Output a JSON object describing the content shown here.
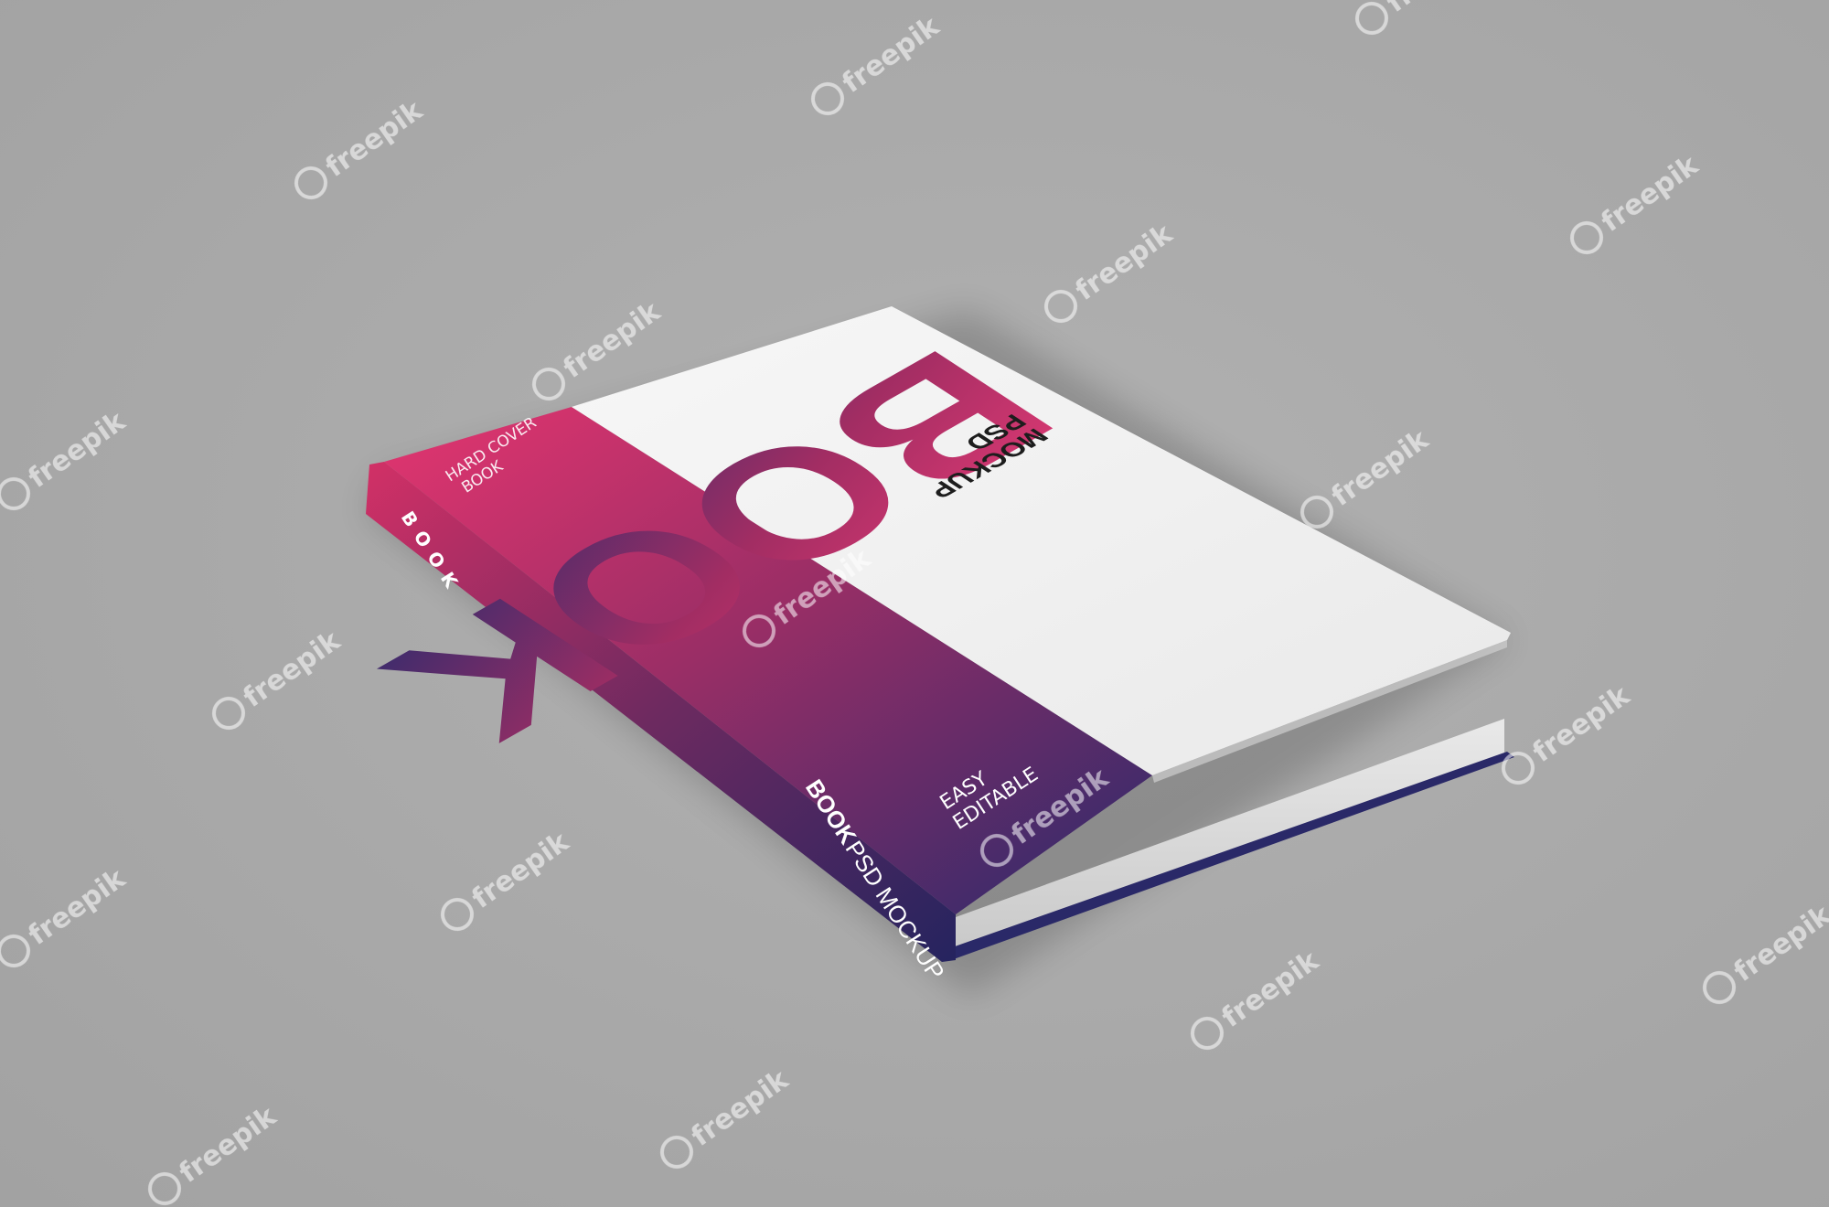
{
  "cover": {
    "big_word": "BOOK",
    "subtitle_line1": "PSD",
    "subtitle_line2": "MOCKUP",
    "tag_line1": "EASY",
    "tag_line2": "EDITABLE",
    "left_line1": "HARD COVER",
    "left_line2": "BOOK",
    "left_vertical": "BOOK",
    "bottom_bold": "BOOK",
    "bottom_regular": "PSD MOCKUP"
  },
  "watermark": {
    "text": "freepik"
  },
  "colors": {
    "background": "#aaaaaa",
    "gradient_top": "#e0336e",
    "gradient_bottom": "#2c2b6c",
    "spine_edge": "#29286a",
    "cover_white": "#f2f2f2",
    "pages": "#dddddd"
  },
  "icons": {
    "watermark_logo": "freepik-logo-icon"
  }
}
